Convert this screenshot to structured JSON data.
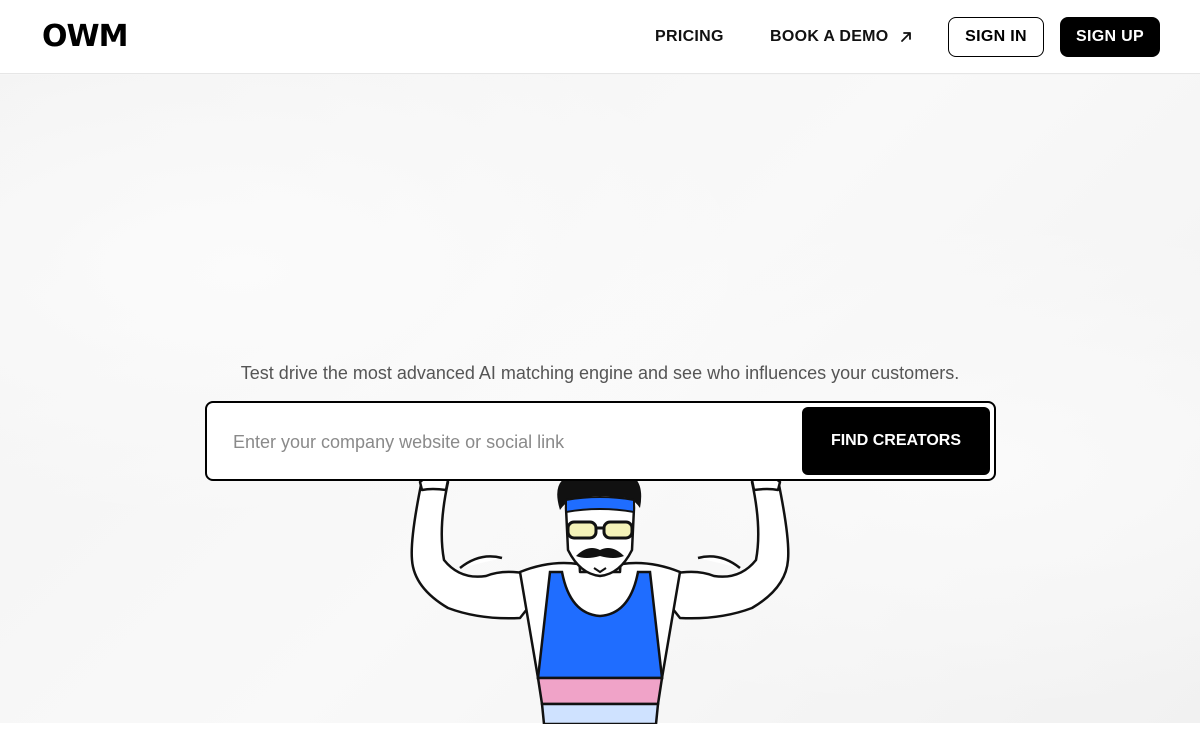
{
  "header": {
    "logo_text": "OWM",
    "nav": {
      "pricing": "PRICING",
      "book_demo": "BOOK A DEMO",
      "sign_in": "SIGN IN",
      "sign_up": "SIGN UP"
    }
  },
  "hero": {
    "tagline": "Test drive the most advanced AI matching engine and see who influences your customers.",
    "search": {
      "placeholder": "Enter your company website or social link",
      "value": "",
      "button_label": "FIND CREATORS"
    },
    "mascot_icon": "strongman-illustration-icon"
  },
  "colors": {
    "accent_blue": "#1f6dff",
    "accent_pink": "#f0a3c8",
    "accent_light_blue": "#cfe2ff",
    "primary": "#000000"
  },
  "icons": {
    "external_arrow": "arrow-up-right-icon"
  }
}
